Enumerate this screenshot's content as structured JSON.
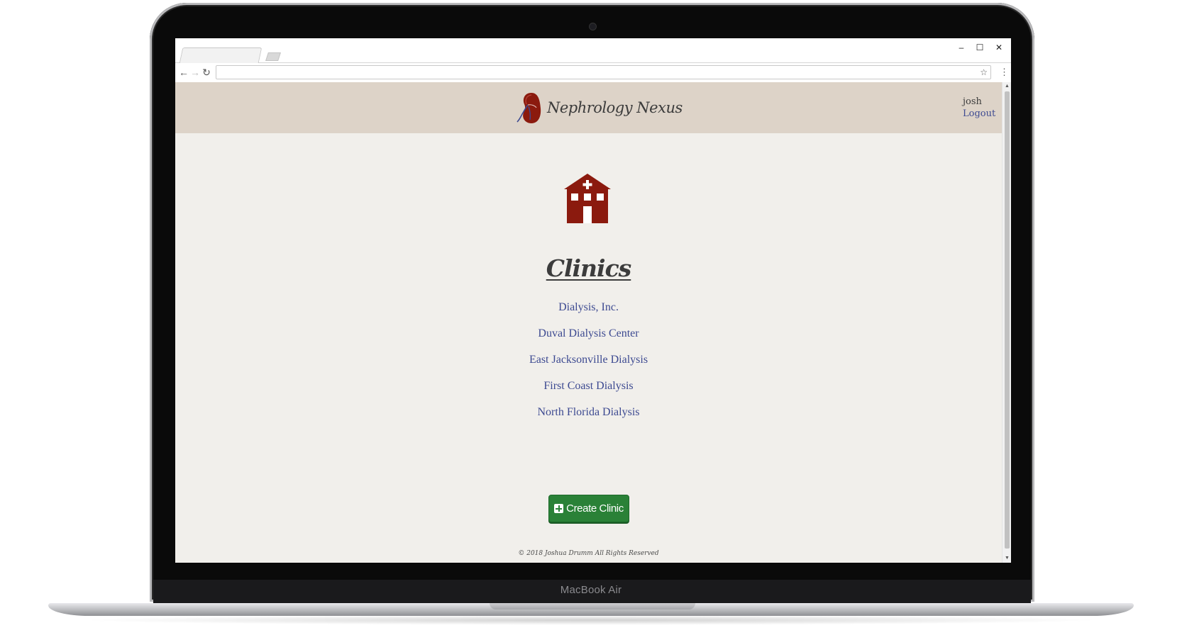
{
  "device": {
    "label": "MacBook Air"
  },
  "browser": {
    "window_controls": {
      "minimize": "–",
      "maximize": "☐",
      "close": "✕"
    },
    "nav": {
      "back": "←",
      "forward": "→",
      "reload": "↻"
    },
    "omnibox": {
      "value": "",
      "bookmark_icon": "☆"
    },
    "menu_icon": "⋮"
  },
  "header": {
    "brand_name": "Nephrology Nexus",
    "user": {
      "username": "josh",
      "logout_label": "Logout"
    }
  },
  "main": {
    "title": "Clinics",
    "clinics": [
      "Dialysis, Inc.",
      "Duval Dialysis Center",
      "East Jacksonville Dialysis",
      "First Coast Dialysis",
      "North Florida Dialysis"
    ],
    "create_button_label": "Create Clinic"
  },
  "footer": {
    "text": "© 2018 Joshua Drumm All Rights Reserved"
  },
  "colors": {
    "header_bg": "#ddd3c8",
    "page_bg": "#f1efeb",
    "link": "#3d4a91",
    "clinic_icon": "#8b1a0e",
    "create_button": "#2a8137"
  }
}
